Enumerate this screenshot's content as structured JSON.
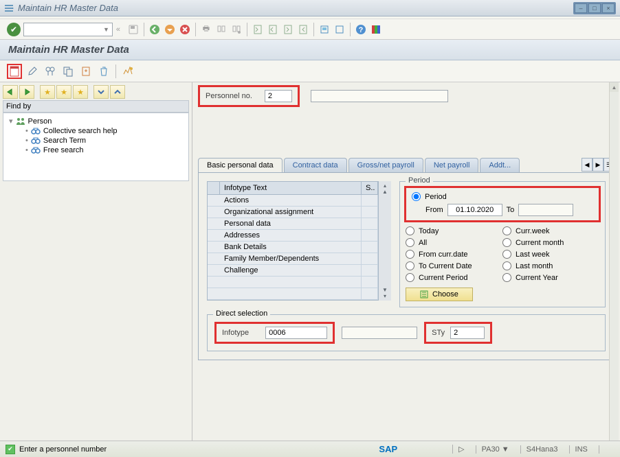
{
  "window": {
    "title": "Maintain HR Master Data"
  },
  "page": {
    "title": "Maintain HR Master Data"
  },
  "form": {
    "personnel_label": "Personnel no.",
    "personnel_value": "2"
  },
  "sidebar": {
    "find_by": "Find by",
    "items": [
      {
        "label": "Person",
        "icon": "people"
      },
      {
        "label": "Collective search help",
        "icon": "binoculars"
      },
      {
        "label": "Search Term",
        "icon": "binoculars"
      },
      {
        "label": "Free search",
        "icon": "binoculars"
      }
    ]
  },
  "tabs": [
    "Basic personal data",
    "Contract data",
    "Gross/net payroll",
    "Net payroll",
    "Addt..."
  ],
  "infotype_table": {
    "header_text": "Infotype Text",
    "header_s": "S..",
    "rows": [
      "Actions",
      "Organizational assignment",
      "Personal data",
      "Addresses",
      "Bank Details",
      "Family Member/Dependents",
      "Challenge"
    ]
  },
  "period": {
    "title": "Period",
    "labels": {
      "period": "Period",
      "from": "From",
      "to": "To",
      "today": "Today",
      "currweek": "Curr.week",
      "all": "All",
      "currmonth": "Current month",
      "fromcurr": "From curr.date",
      "lastweek": "Last week",
      "tocurrent": "To Current Date",
      "lastmonth": "Last month",
      "currperiod": "Current Period",
      "curryear": "Current Year",
      "choose": "Choose"
    },
    "from_value": "01.10.2020",
    "to_value": ""
  },
  "direct": {
    "title": "Direct selection",
    "infotype_label": "Infotype",
    "infotype_value": "0006",
    "sty_label": "STy",
    "sty_value": "2"
  },
  "status": {
    "message": "Enter a personnel number",
    "tcode": "PA30",
    "system": "S4Hana3",
    "mode": "INS"
  }
}
